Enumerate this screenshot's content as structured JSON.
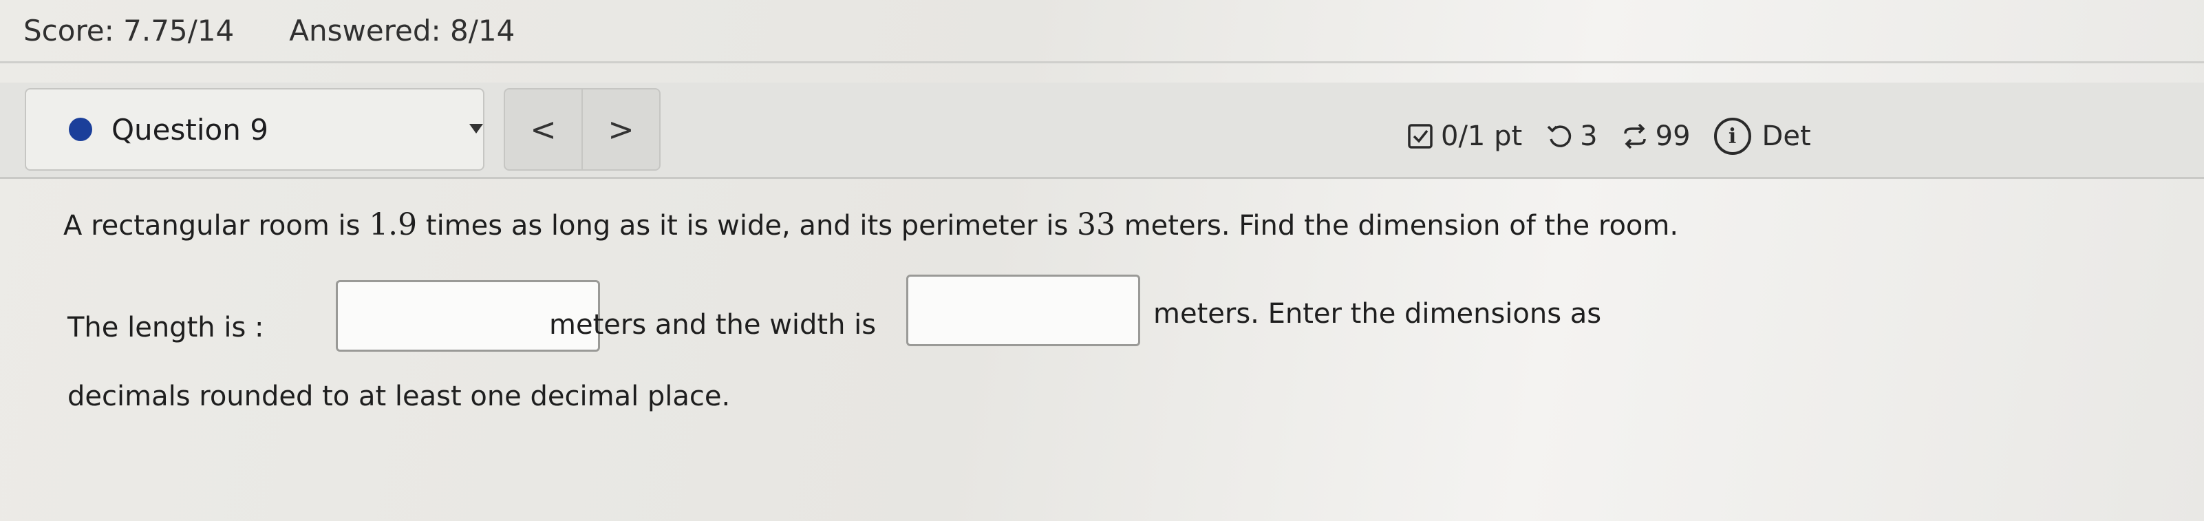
{
  "scorebar": {
    "score": "Score: 7.75/14",
    "answered": "Answered: 8/14"
  },
  "question_nav": {
    "selected_question": "Question 9",
    "prev_glyph": "<",
    "next_glyph": ">"
  },
  "status": {
    "points": "0/1 pt",
    "retries": "3",
    "attempts": "99",
    "details": "Det"
  },
  "question": {
    "stem_part1": "A rectangular room is ",
    "factor": "1.9",
    "stem_part2": " times as long as it is wide, and its perimeter is ",
    "perimeter": "33",
    "stem_part3": " meters. Find the dimension of the room.",
    "length_label": "The length is :",
    "width_label": "meters and the width is",
    "after_width": "meters. Enter the dimensions as",
    "note": "decimals rounded to at least one decimal place.",
    "length_value": "",
    "width_value": ""
  },
  "colors": {
    "question_dot": "#1b3f9a",
    "background": "#e9e9e6"
  },
  "icons": {
    "points": "checkbox-icon",
    "retries": "retry-icon",
    "attempts": "repeat-icon",
    "details": "info-icon"
  }
}
